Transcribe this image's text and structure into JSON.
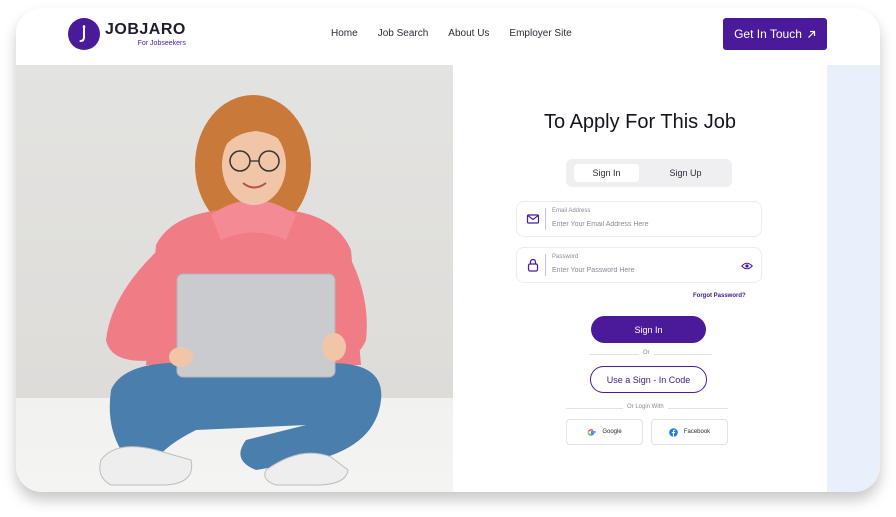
{
  "brand": {
    "name": "JOBJARO",
    "tagline": "For Jobseekers",
    "accent": "#4a1a9a"
  },
  "nav": {
    "items": [
      "Home",
      "Job Search",
      "About Us",
      "Employer Site"
    ]
  },
  "cta": {
    "label": "Get In Touch",
    "icon": "arrow-up-right-icon"
  },
  "form": {
    "title": "To Apply For This Job",
    "tabs": {
      "signin": "Sign In",
      "signup": "Sign Up",
      "active": "signin"
    },
    "email": {
      "label": "Email Address",
      "placeholder": "Enter Your Email Address Here",
      "icon": "mail-icon"
    },
    "password": {
      "label": "Password",
      "placeholder": "Enter Your Password Here",
      "icon": "lock-icon",
      "toggle_icon": "eye-icon"
    },
    "forgot": "Forgot Password?",
    "submit": "Sign In",
    "or": "Or",
    "code_button": "Use a Sign - In Code",
    "or_login_with": "Or Login With",
    "social": {
      "google": "Google",
      "facebook": "Facebook"
    }
  },
  "colors": {
    "panel_strip": "#e8f0fb",
    "google_blue": "#4285F4",
    "facebook_blue": "#1877F2"
  }
}
